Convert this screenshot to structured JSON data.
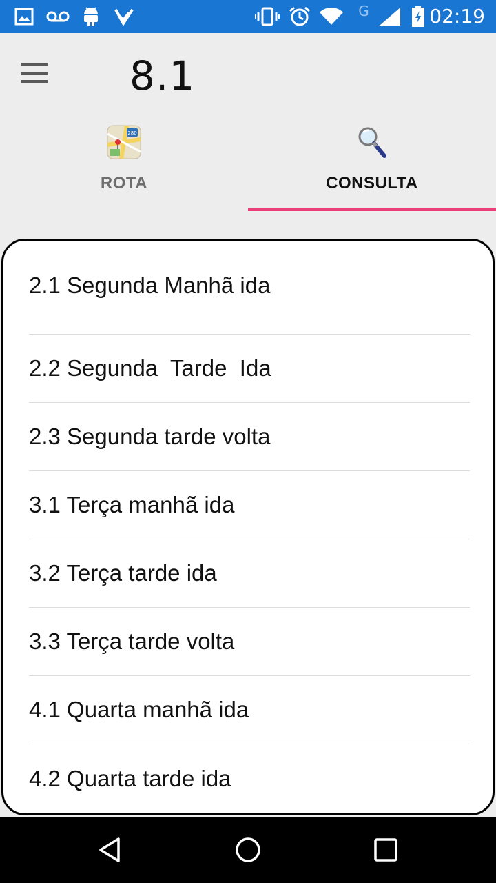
{
  "status_bar": {
    "time": "02:19",
    "network_label": "G",
    "bg_color": "#1976d2",
    "icons": [
      "image-icon",
      "voicemail-icon",
      "android-icon",
      "check-app-icon",
      "vibrate-icon",
      "alarm-icon",
      "wifi-icon",
      "signal-icon",
      "battery-icon"
    ]
  },
  "app_bar": {
    "title": "8.1",
    "menu_icon": "hamburger-menu-icon"
  },
  "tabs": [
    {
      "label": "ROTA",
      "icon": "map-icon",
      "active": false
    },
    {
      "label": "CONSULTA",
      "icon": "magnifier-icon",
      "active": true
    }
  ],
  "accent_color": "#ec407a",
  "list": {
    "items": [
      "2.1 Segunda Manhã ida",
      "2.2 Segunda  Tarde  Ida",
      "2.3 Segunda tarde volta",
      "3.1 Terça manhã ida",
      "3.2 Terça tarde ida",
      "3.3 Terça tarde volta",
      "4.1 Quarta manhã ida",
      "4.2 Quarta tarde ida"
    ]
  },
  "nav_bar": {
    "buttons": [
      "back-icon",
      "home-icon",
      "recents-icon"
    ]
  }
}
